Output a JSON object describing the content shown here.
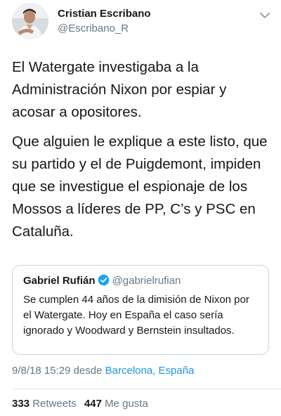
{
  "author": {
    "name": "Cristian Escribano",
    "handle": "@Escribano_R",
    "avatar_icon": "user-photo"
  },
  "menu_icon": "chevron-down-icon",
  "tweet": {
    "paragraphs": [
      "El Watergate investigaba a la Administración Nixon por espiar y acosar a opositores.",
      "Que alguien le explique a este listo, que su partido y el de Puigdemont, impiden que se investigue el espionaje de los Mossos a líderes de PP, C’s y PSC en Cataluña."
    ]
  },
  "quoted": {
    "name": "Gabriel Rufián",
    "handle": "@gabrielrufian",
    "verified": true,
    "text": "Se cumplen 44 años de la dimisión de Nixon por el Watergate. Hoy en España el caso sería ignorado y Woodward y Bernstein insultados."
  },
  "meta": {
    "datetime": "9/8/18 15:29",
    "from_label": "desde",
    "location": "Barcelona, España"
  },
  "stats": {
    "retweets_count": "333",
    "retweets_label": "Retweets",
    "likes_count": "447",
    "likes_label": "Me gusta"
  },
  "colors": {
    "link": "#1b95e0",
    "secondary_text": "#657786",
    "border": "#ccd6dd"
  }
}
